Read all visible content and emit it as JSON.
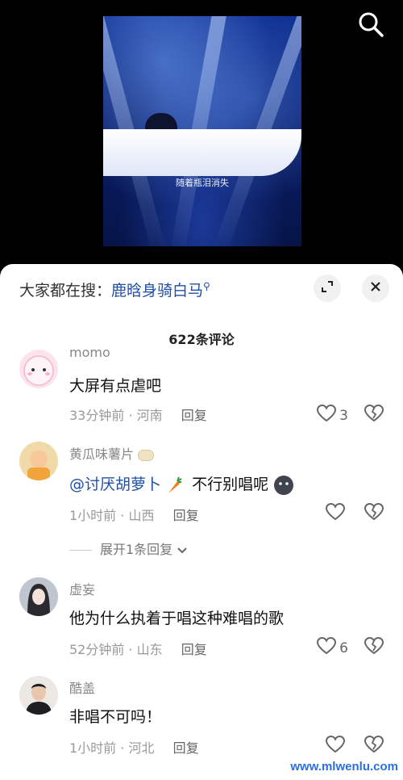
{
  "video": {
    "subtitle": "随着瓶泪消失"
  },
  "sheet": {
    "search_prefix": "大家都在搜：",
    "search_term": "鹿晗身骑白马",
    "comment_count_title": "622条评论"
  },
  "comments": [
    {
      "username": "momo",
      "text": "大屏有点虐吧",
      "time": "33分钟前",
      "location": "河南",
      "reply_label": "回复",
      "likes": "3"
    },
    {
      "username": "黄瓜味薯片",
      "mention": "@讨厌胡萝卜",
      "text": "不行别唱呢",
      "time": "1小时前",
      "location": "山西",
      "reply_label": "回复",
      "likes": "",
      "expand_label": "展开1条回复"
    },
    {
      "username": "虚妄",
      "text": "他为什么执着于唱这种难唱的歌",
      "time": "52分钟前",
      "location": "山东",
      "reply_label": "回复",
      "likes": "6"
    },
    {
      "username": "酷盖",
      "text": "非唱不可吗！",
      "time": "1小时前",
      "location": "河北",
      "reply_label": "回复",
      "likes": ""
    }
  ],
  "meta_separator": "·",
  "watermark": "www.mlwenlu.com",
  "colors": {
    "mention": "#1f4fa6",
    "secondary_text": "#999999",
    "background_video": "#000000",
    "sheet": "#ffffff"
  },
  "icons": [
    "search-icon",
    "expand-icon",
    "close-icon",
    "heart-icon",
    "broken-heart-icon",
    "chevron-down-icon"
  ]
}
